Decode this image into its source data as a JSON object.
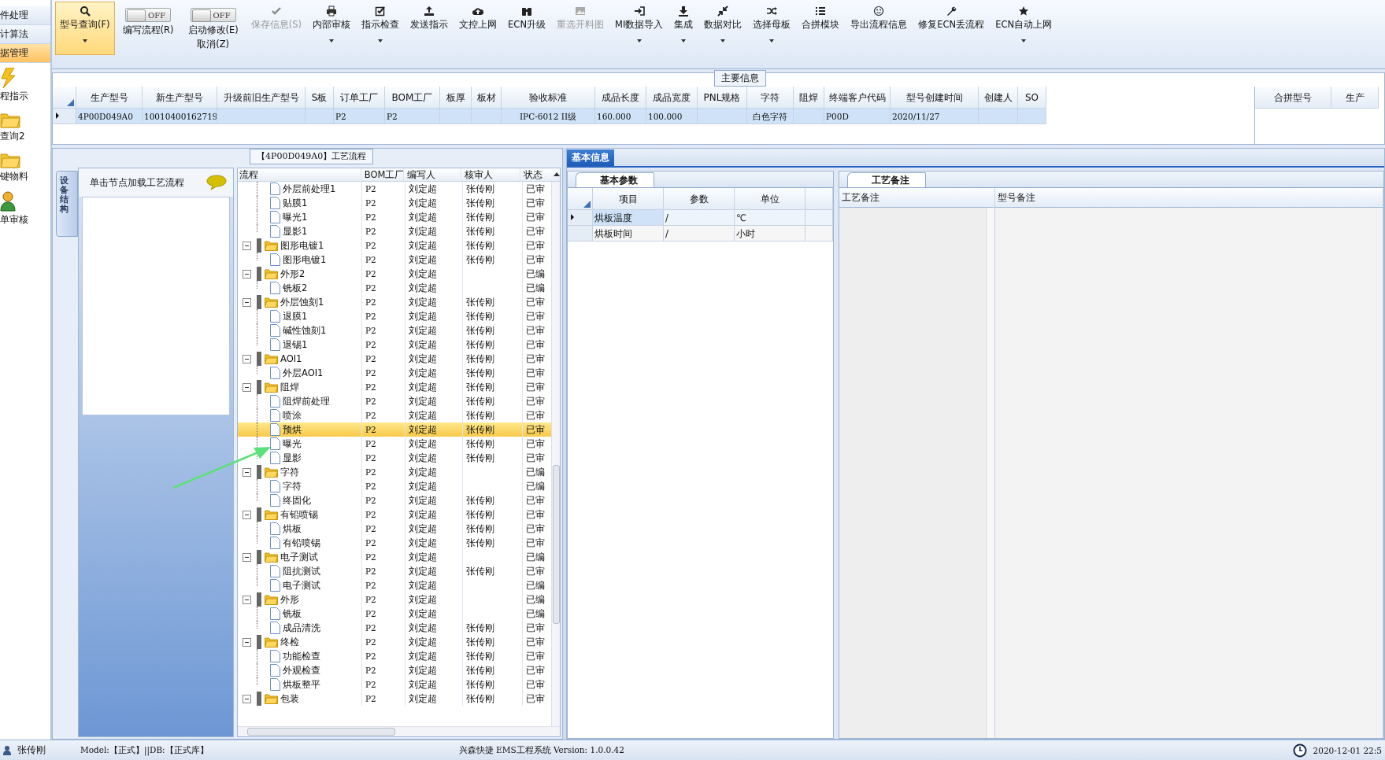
{
  "sidebar": {
    "items": [
      {
        "label": "件处理",
        "kind": "plain",
        "selected": false
      },
      {
        "label": "计算法",
        "kind": "plain",
        "selected": false
      },
      {
        "label": "据管理",
        "kind": "plain",
        "selected": true
      },
      {
        "label": "程指示",
        "kind": "bolt",
        "selected": false
      },
      {
        "label": "查询2",
        "kind": "folder",
        "selected": false
      },
      {
        "label": "键物料",
        "kind": "folder",
        "selected": false
      },
      {
        "label": "单审核",
        "kind": "user",
        "selected": false
      }
    ]
  },
  "toolbar": {
    "buttons": [
      {
        "kind": "button",
        "label": "型号查询(F)",
        "selected": true,
        "disabled": false,
        "dropdown": true
      },
      {
        "kind": "toggle",
        "switch_text": "OFF",
        "on": false,
        "label": "编写流程(R)"
      },
      {
        "kind": "toggle",
        "switch_text": "OFF",
        "on": false,
        "label": "启动修改(E)",
        "sublabel": "取消(Z)"
      },
      {
        "kind": "button",
        "label": "保存信息(S)",
        "selected": false,
        "disabled": true,
        "dropdown": false
      },
      {
        "kind": "button",
        "label": "内部审核",
        "selected": false,
        "disabled": false,
        "dropdown": true
      },
      {
        "kind": "button",
        "label": "指示检查",
        "selected": false,
        "disabled": false,
        "dropdown": true
      },
      {
        "kind": "button",
        "label": "发送指示",
        "selected": false,
        "disabled": false,
        "dropdown": false
      },
      {
        "kind": "button",
        "label": "文控上网",
        "selected": false,
        "disabled": false,
        "dropdown": false
      },
      {
        "kind": "button",
        "label": "ECN升级",
        "selected": false,
        "disabled": false,
        "dropdown": false
      },
      {
        "kind": "button",
        "label": "重选开料图",
        "selected": false,
        "disabled": true,
        "dropdown": false
      },
      {
        "kind": "button",
        "label": "MI数据导入",
        "selected": false,
        "disabled": false,
        "dropdown": true
      },
      {
        "kind": "button",
        "label": "集成",
        "selected": false,
        "disabled": false,
        "dropdown": true
      },
      {
        "kind": "button",
        "label": "数据对比",
        "selected": false,
        "disabled": false,
        "dropdown": true
      },
      {
        "kind": "button",
        "label": "选择母板",
        "selected": false,
        "disabled": false,
        "dropdown": true
      },
      {
        "kind": "button",
        "label": "合拼模块",
        "selected": false,
        "disabled": false,
        "dropdown": false
      },
      {
        "kind": "button",
        "label": "导出流程信息",
        "selected": false,
        "disabled": false,
        "dropdown": false
      },
      {
        "kind": "button",
        "label": "修复ECN丢流程",
        "selected": false,
        "disabled": false,
        "dropdown": false
      },
      {
        "kind": "button",
        "label": "ECN自动上网",
        "selected": false,
        "disabled": false,
        "dropdown": true
      }
    ]
  },
  "main_info": {
    "title": "主要信息",
    "columns": [
      "生产型号",
      "新生产型号",
      "升级前旧生产型号",
      "S板",
      "订单工厂",
      "BOM工厂",
      "板厚",
      "板材",
      "验收标准",
      "成品长度",
      "成品宽度",
      "PNL规格",
      "字符",
      "阻焊",
      "终端客户代码",
      "型号创建时间",
      "创建人",
      "SO"
    ],
    "rows": [
      {
        "current": true,
        "cells": [
          "4P00D049A0",
          "10010400162719",
          null,
          null,
          "P2",
          "P2",
          null,
          null,
          "IPC-6012 II级",
          "160.000",
          "100.000",
          null,
          "白色字符",
          null,
          "P00D",
          "2020/11/27",
          null,
          null
        ]
      }
    ],
    "side_columns": [
      "合拼型号",
      "生产"
    ]
  },
  "process": {
    "title": "【4P00D049A0】工艺流程",
    "side_tab": "设备结构",
    "hint": "单击节点加载工艺流程",
    "columns": [
      "流程",
      "BOM工厂",
      "编写人",
      "核审人",
      "状态"
    ],
    "partial_children": [
      {
        "name": "外层前处理1",
        "bom": "P2",
        "writer": "刘定超",
        "reviewer": "张传刚",
        "status": "已审",
        "selected": false
      },
      {
        "name": "贴膜1",
        "bom": "P2",
        "writer": "刘定超",
        "reviewer": "张传刚",
        "status": "已审",
        "selected": false
      },
      {
        "name": "曝光1",
        "bom": "P2",
        "writer": "刘定超",
        "reviewer": "张传刚",
        "status": "已审",
        "selected": false
      },
      {
        "name": "显影1",
        "bom": "P2",
        "writer": "刘定超",
        "reviewer": "张传刚",
        "status": "已审",
        "selected": false
      }
    ],
    "nodes": [
      {
        "name": "图形电镀1",
        "bom": "P2",
        "writer": "刘定超",
        "reviewer": "张传刚",
        "status": "已审",
        "selected": false,
        "expanded": true,
        "children": [
          {
            "name": "图形电镀1",
            "bom": "P2",
            "writer": "刘定超",
            "reviewer": "张传刚",
            "status": "已审",
            "selected": false
          }
        ]
      },
      {
        "name": "外形2",
        "bom": "P2",
        "writer": "刘定超",
        "status": "已编",
        "selected": false,
        "expanded": true,
        "children": [
          {
            "name": "铣板2",
            "bom": "P2",
            "writer": "刘定超",
            "status": "已编",
            "selected": false
          }
        ]
      },
      {
        "name": "外层蚀刻1",
        "bom": "P2",
        "writer": "刘定超",
        "reviewer": "张传刚",
        "status": "已审",
        "selected": false,
        "expanded": true,
        "children": [
          {
            "name": "退膜1",
            "bom": "P2",
            "writer": "刘定超",
            "reviewer": "张传刚",
            "status": "已审",
            "selected": false
          },
          {
            "name": "碱性蚀刻1",
            "bom": "P2",
            "writer": "刘定超",
            "reviewer": "张传刚",
            "status": "已审",
            "selected": false
          },
          {
            "name": "退锡1",
            "bom": "P2",
            "writer": "刘定超",
            "reviewer": "张传刚",
            "status": "已审",
            "selected": false
          }
        ]
      },
      {
        "name": "AOI1",
        "bom": "P2",
        "writer": "刘定超",
        "reviewer": "张传刚",
        "status": "已审",
        "selected": false,
        "expanded": true,
        "children": [
          {
            "name": "外层AOI1",
            "bom": "P2",
            "writer": "刘定超",
            "reviewer": "张传刚",
            "status": "已审",
            "selected": false
          }
        ]
      },
      {
        "name": "阻焊",
        "bom": "P2",
        "writer": "刘定超",
        "reviewer": "张传刚",
        "status": "已审",
        "selected": false,
        "expanded": true,
        "children": [
          {
            "name": "阻焊前处理",
            "bom": "P2",
            "writer": "刘定超",
            "reviewer": "张传刚",
            "status": "已审",
            "selected": false
          },
          {
            "name": "喷涂",
            "bom": "P2",
            "writer": "刘定超",
            "reviewer": "张传刚",
            "status": "已审",
            "selected": false
          },
          {
            "name": "预烘",
            "bom": "P2",
            "writer": "刘定超",
            "reviewer": "张传刚",
            "status": "已审",
            "selected": true
          },
          {
            "name": "曝光",
            "bom": "P2",
            "writer": "刘定超",
            "reviewer": "张传刚",
            "status": "已审",
            "selected": false
          },
          {
            "name": "显影",
            "bom": "P2",
            "writer": "刘定超",
            "reviewer": "张传刚",
            "status": "已审",
            "selected": false
          }
        ]
      },
      {
        "name": "字符",
        "bom": "P2",
        "writer": "刘定超",
        "status": "已编",
        "selected": false,
        "expanded": true,
        "children": [
          {
            "name": "字符",
            "bom": "P2",
            "writer": "刘定超",
            "status": "已编",
            "selected": false
          },
          {
            "name": "终固化",
            "bom": "P2",
            "writer": "刘定超",
            "reviewer": "张传刚",
            "status": "已审",
            "selected": false
          }
        ]
      },
      {
        "name": "有铅喷锡",
        "bom": "P2",
        "writer": "刘定超",
        "reviewer": "张传刚",
        "status": "已审",
        "selected": false,
        "expanded": true,
        "children": [
          {
            "name": "烘板",
            "bom": "P2",
            "writer": "刘定超",
            "reviewer": "张传刚",
            "status": "已审",
            "selected": false
          },
          {
            "name": "有铅喷锡",
            "bom": "P2",
            "writer": "刘定超",
            "reviewer": "张传刚",
            "status": "已审",
            "selected": false
          }
        ]
      },
      {
        "name": "电子测试",
        "bom": "P2",
        "writer": "刘定超",
        "status": "已编",
        "selected": false,
        "expanded": true,
        "children": [
          {
            "name": "阻抗测试",
            "bom": "P2",
            "writer": "刘定超",
            "reviewer": "张传刚",
            "status": "已审",
            "selected": false
          },
          {
            "name": "电子测试",
            "bom": "P2",
            "writer": "刘定超",
            "status": "已编",
            "selected": false
          }
        ]
      },
      {
        "name": "外形",
        "bom": "P2",
        "writer": "刘定超",
        "status": "已编",
        "selected": false,
        "expanded": true,
        "children": [
          {
            "name": "铣板",
            "bom": "P2",
            "writer": "刘定超",
            "status": "已编",
            "selected": false
          },
          {
            "name": "成品清洗",
            "bom": "P2",
            "writer": "刘定超",
            "reviewer": "张传刚",
            "status": "已审",
            "selected": false
          }
        ]
      },
      {
        "name": "终检",
        "bom": "P2",
        "writer": "刘定超",
        "reviewer": "张传刚",
        "status": "已审",
        "selected": false,
        "expanded": true,
        "children": [
          {
            "name": "功能检查",
            "bom": "P2",
            "writer": "刘定超",
            "reviewer": "张传刚",
            "status": "已审",
            "selected": false
          },
          {
            "name": "外观检查",
            "bom": "P2",
            "writer": "刘定超",
            "reviewer": "张传刚",
            "status": "已审",
            "selected": false
          },
          {
            "name": "烘板整平",
            "bom": "P2",
            "writer": "刘定超",
            "reviewer": "张传刚",
            "status": "已审",
            "selected": false
          }
        ]
      },
      {
        "name": "包装",
        "bom": "P2",
        "writer": "刘定超",
        "reviewer": "张传刚",
        "status": "已审",
        "selected": false,
        "expanded": true
      }
    ]
  },
  "basic_info": {
    "tab": "基本信息",
    "selected": true,
    "params": {
      "tab": "基本参数",
      "columns": [
        "项目",
        "参数",
        "单位"
      ],
      "rows": [
        {
          "current": true,
          "cells": [
            "烘板温度",
            "/",
            "℃"
          ]
        },
        {
          "current": false,
          "cells": [
            "烘板时间",
            "/",
            "小时"
          ]
        }
      ]
    },
    "notes": {
      "tab": "工艺备注",
      "columns": [
        "工艺备注",
        "型号备注"
      ]
    }
  },
  "status_bar": {
    "user": "张传刚",
    "db": "Model:【正式】||DB:【正式库】",
    "app": "兴森快捷 EMS工程系统 Version: 1.0.0.42",
    "time": "2020-12-01 22:5"
  }
}
